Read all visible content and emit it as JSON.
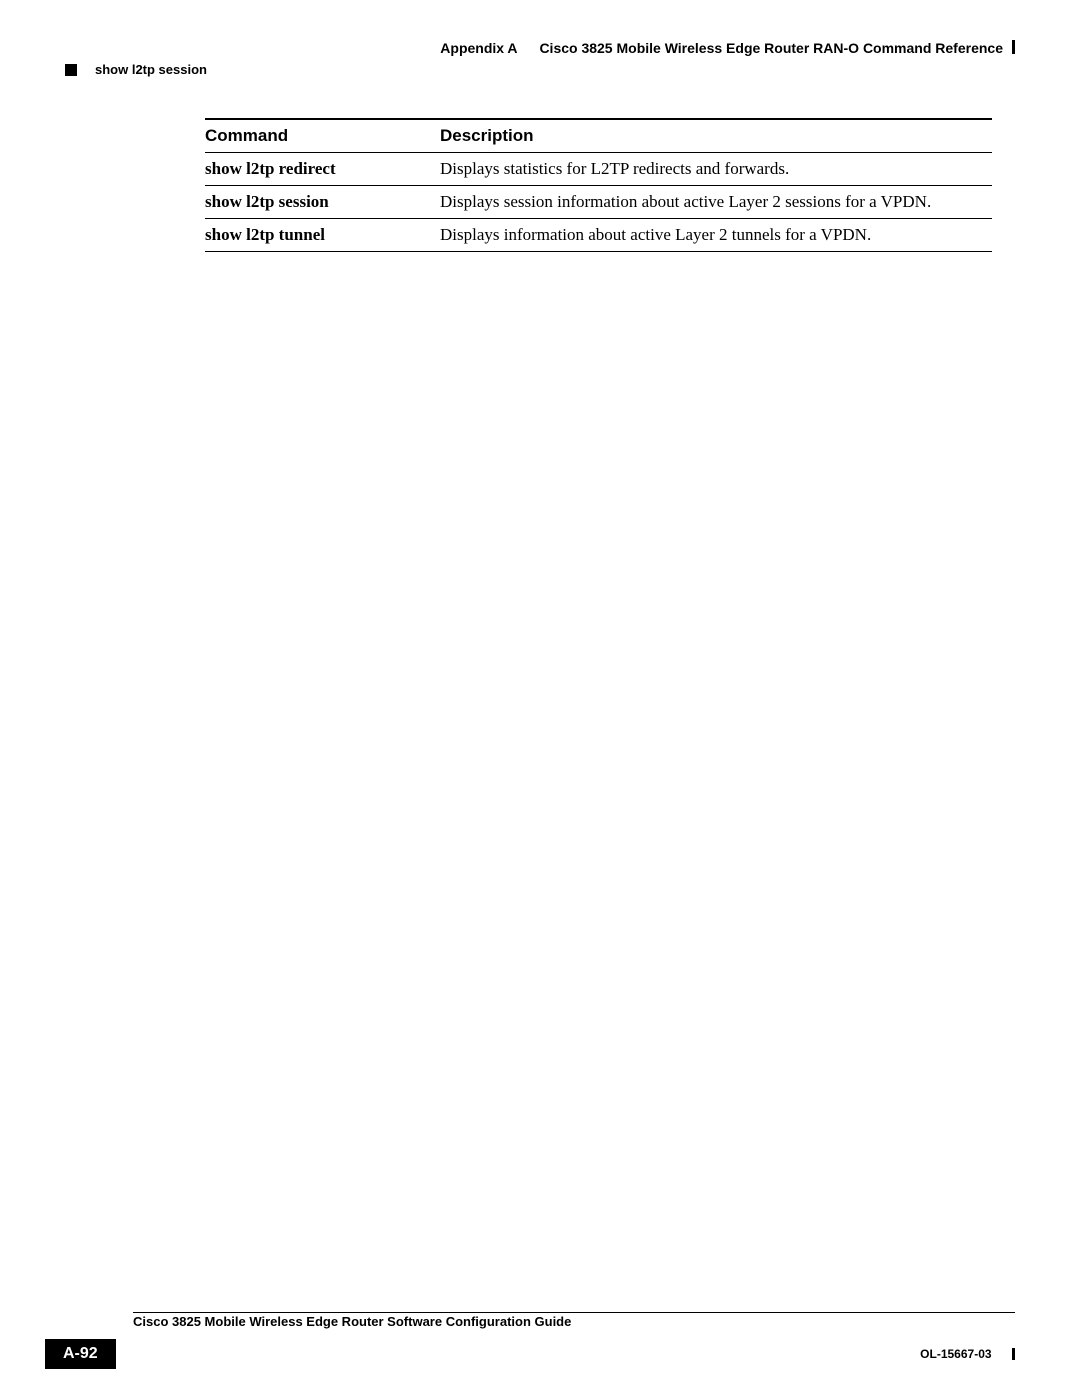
{
  "header": {
    "appendix": "Appendix A",
    "title": "Cisco 3825 Mobile Wireless Edge Router RAN-O Command Reference",
    "section": "show l2tp session"
  },
  "table": {
    "headers": {
      "col1": "Command",
      "col2": "Description"
    },
    "rows": [
      {
        "cmd": "show l2tp redirect",
        "desc": "Displays statistics for L2TP redirects and forwards."
      },
      {
        "cmd": "show l2tp session",
        "desc": "Displays session information about active Layer 2 sessions for a VPDN."
      },
      {
        "cmd": "show l2tp tunnel",
        "desc": "Displays information about active Layer 2 tunnels for a VPDN."
      }
    ]
  },
  "footer": {
    "guide": "Cisco 3825 Mobile Wireless Edge Router Software Configuration Guide",
    "page": "A-92",
    "docid": "OL-15667-03"
  }
}
